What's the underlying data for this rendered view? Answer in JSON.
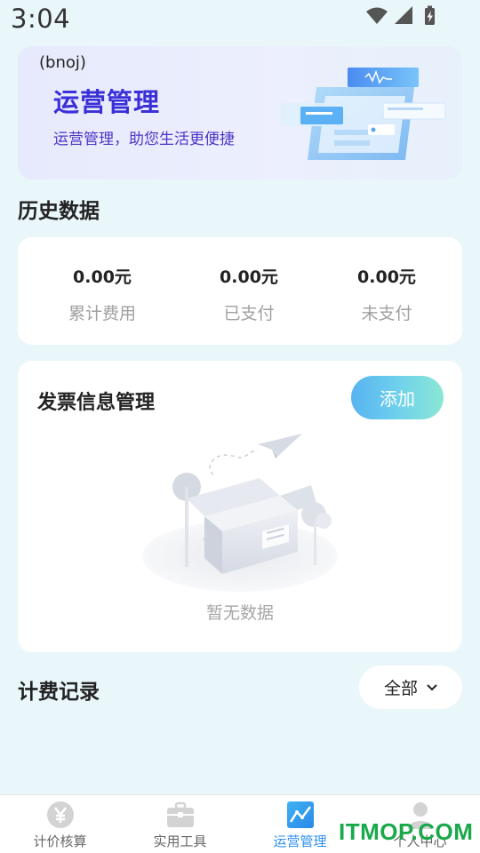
{
  "status_bar": {
    "time": "3:04",
    "icons": [
      "wifi-icon",
      "cellular-signal-icon",
      "battery-charging-icon"
    ]
  },
  "banner": {
    "tag": "(bnoj)",
    "title": "运营管理",
    "subtitle": "运营管理，助您生活更便捷",
    "title_color": "#3b2fd8"
  },
  "history": {
    "title": "历史数据",
    "stats": [
      {
        "value": "0.00元",
        "label": "累计费用"
      },
      {
        "value": "0.00元",
        "label": "已支付"
      },
      {
        "value": "0.00元",
        "label": "未支付"
      }
    ]
  },
  "invoice": {
    "title": "发票信息管理",
    "add_label": "添加",
    "empty_text": "暂无数据"
  },
  "billing": {
    "title": "计费记录",
    "filter_label": "全部"
  },
  "tabbar": {
    "active_color": "#2e8ff0",
    "items": [
      {
        "label": "计价核算",
        "icon": "yen-coin-icon"
      },
      {
        "label": "实用工具",
        "icon": "toolbox-icon"
      },
      {
        "label": "运营管理",
        "icon": "trend-chart-icon"
      },
      {
        "label": "个人中心",
        "icon": "person-icon"
      }
    ]
  },
  "watermark": {
    "text": "ITMOP.COM",
    "color": "#19a84a"
  }
}
